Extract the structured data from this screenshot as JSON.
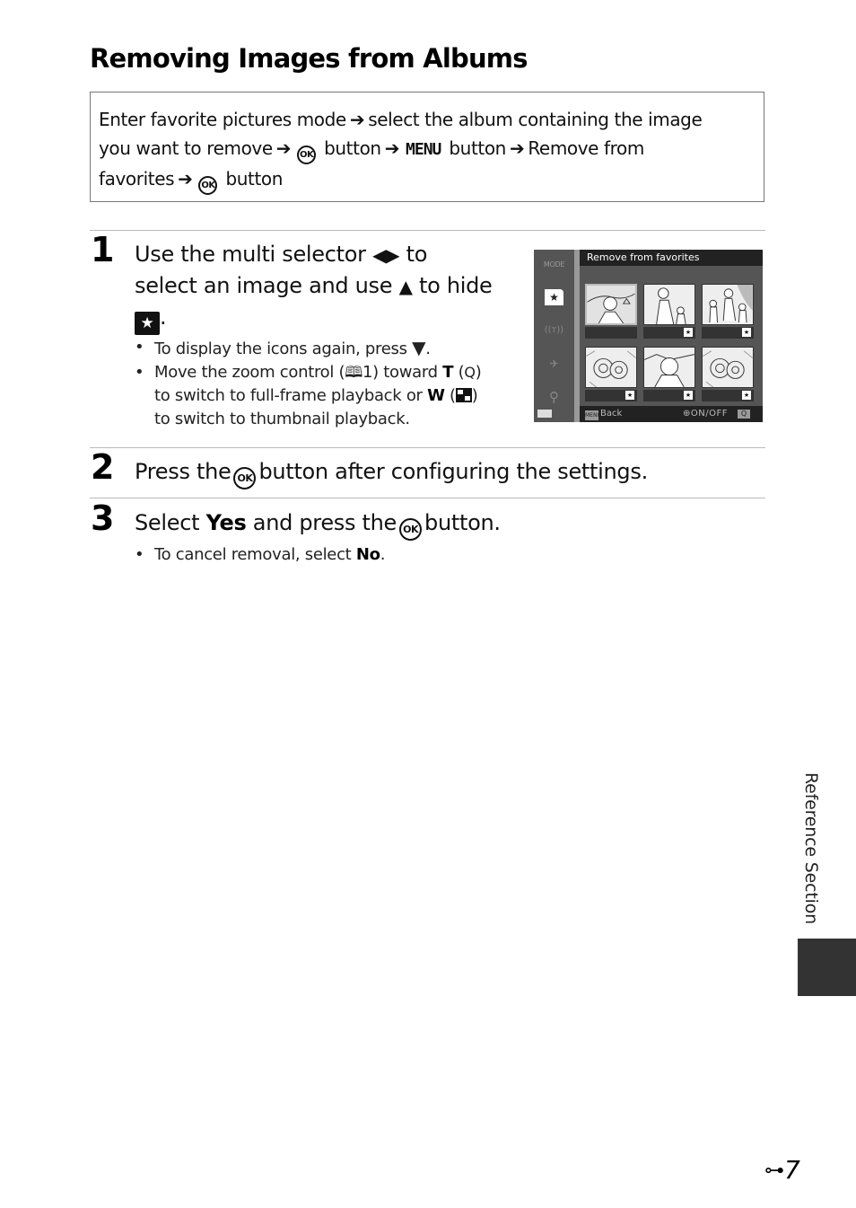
{
  "page": {
    "title": "Removing Images from Albums",
    "nav_path": {
      "line1_a": "Enter favorite pictures mode",
      "line1_b": "select the album containing the image",
      "line2_a": "you want to remove",
      "ok": "OK",
      "button": "button",
      "menu": "MENU",
      "line2_b": "Remove from",
      "line3_a": "favorites",
      "arrow": "➔"
    },
    "steps": [
      {
        "number": "1",
        "heading_parts": [
          "Use the multi selector",
          "◀▶",
          "to",
          "select an image and use",
          "▲",
          "to hide",
          "★",
          "."
        ],
        "bullets": [
          {
            "text": "To display the icons again, press",
            "glyph": "▼",
            "end": "."
          },
          {
            "line1_a": "Move the zoom control (",
            "book": "🕮",
            "line1_b": "1) toward",
            "T": "T",
            "mag": "Q",
            "line2_a": "to switch to full-frame playback or",
            "W": "W",
            "line3": "to switch to thumbnail playback."
          }
        ]
      },
      {
        "number": "2",
        "heading_a": "Press the",
        "ok": "OK",
        "heading_b": "button after configuring the settings."
      },
      {
        "number": "3",
        "heading_a": "Select",
        "yes": "Yes",
        "heading_b": "and press the",
        "ok": "OK",
        "heading_c": "button.",
        "bullets": [
          {
            "text": "To cancel removal, select",
            "bold": "No",
            "end": "."
          }
        ]
      }
    ],
    "camera_screen": {
      "title": "Remove from favorites",
      "side_items": [
        "MODE",
        "favorite-pictures",
        "wifi",
        "gps",
        "setup"
      ],
      "mode_label": "MODE",
      "footer_back_icon": "MENU",
      "footer_back": "Back",
      "footer_toggle": "⊕ON/OFF",
      "footer_zoom": "Q",
      "thumbnails": [
        {
          "subject": "portrait-woman-boat",
          "selected": true,
          "favorite": false
        },
        {
          "subject": "woman-child",
          "selected": false,
          "favorite": true
        },
        {
          "subject": "woman-two-children",
          "selected": false,
          "favorite": true
        },
        {
          "subject": "flowers",
          "selected": false,
          "favorite": true
        },
        {
          "subject": "portrait-woman",
          "selected": false,
          "favorite": true
        },
        {
          "subject": "flowers",
          "selected": false,
          "favorite": true
        }
      ],
      "star": "★"
    },
    "side_tab": "Reference Section",
    "page_number": "7",
    "page_prefix_icon": "binoculars"
  }
}
